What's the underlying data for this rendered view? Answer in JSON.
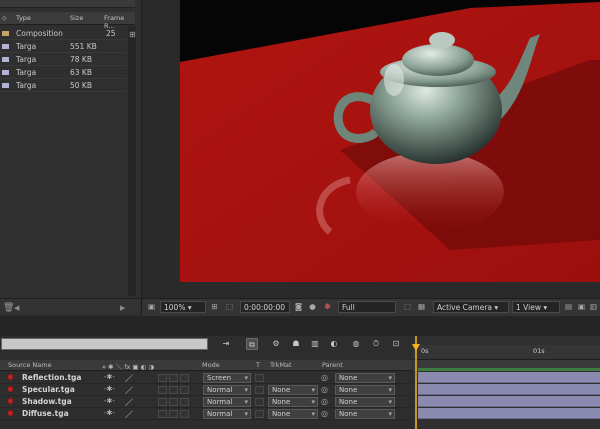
{
  "project": {
    "columns": {
      "type": "Type",
      "size": "Size",
      "frame_rate": "Frame R..."
    },
    "items": [
      {
        "type": "Composition",
        "size": "",
        "frame_rate": "25",
        "color": "#c8a26a"
      },
      {
        "type": "Targa",
        "size": "551 KB",
        "frame_rate": "",
        "color": "#b3b3d6"
      },
      {
        "type": "Targa",
        "size": "78 KB",
        "frame_rate": "",
        "color": "#b3b3d6"
      },
      {
        "type": "Targa",
        "size": "63 KB",
        "frame_rate": "",
        "color": "#b3b3d6"
      },
      {
        "type": "Targa",
        "size": "50 KB",
        "frame_rate": "",
        "color": "#b3b3d6"
      }
    ]
  },
  "viewer": {
    "zoom": "100%",
    "timecode": "0:00:00:00",
    "resolution": "Full",
    "camera": "Active Camera",
    "view_layout": "1 View"
  },
  "timeline": {
    "columns": {
      "source_name": "Source Name",
      "mode": "Mode",
      "t": "T",
      "trkmat": "TrkMat",
      "parent": "Parent"
    },
    "ruler": {
      "start": "0s",
      "mark": "01s"
    },
    "layers": [
      {
        "name": "Reflection.tga",
        "mode": "Screen",
        "trkmat": "",
        "parent": "None"
      },
      {
        "name": "Specular.tga",
        "mode": "Normal",
        "trkmat": "None",
        "parent": "None"
      },
      {
        "name": "Shadow.tga",
        "mode": "Normal",
        "trkmat": "None",
        "parent": "None"
      },
      {
        "name": "Diffuse.tga",
        "mode": "Normal",
        "trkmat": "None",
        "parent": "None"
      }
    ]
  },
  "colors": {
    "floor": "#a8110f",
    "teapot": "#7f978c",
    "layer_bar": "#8a8ab0",
    "playhead": "#f0b020"
  }
}
